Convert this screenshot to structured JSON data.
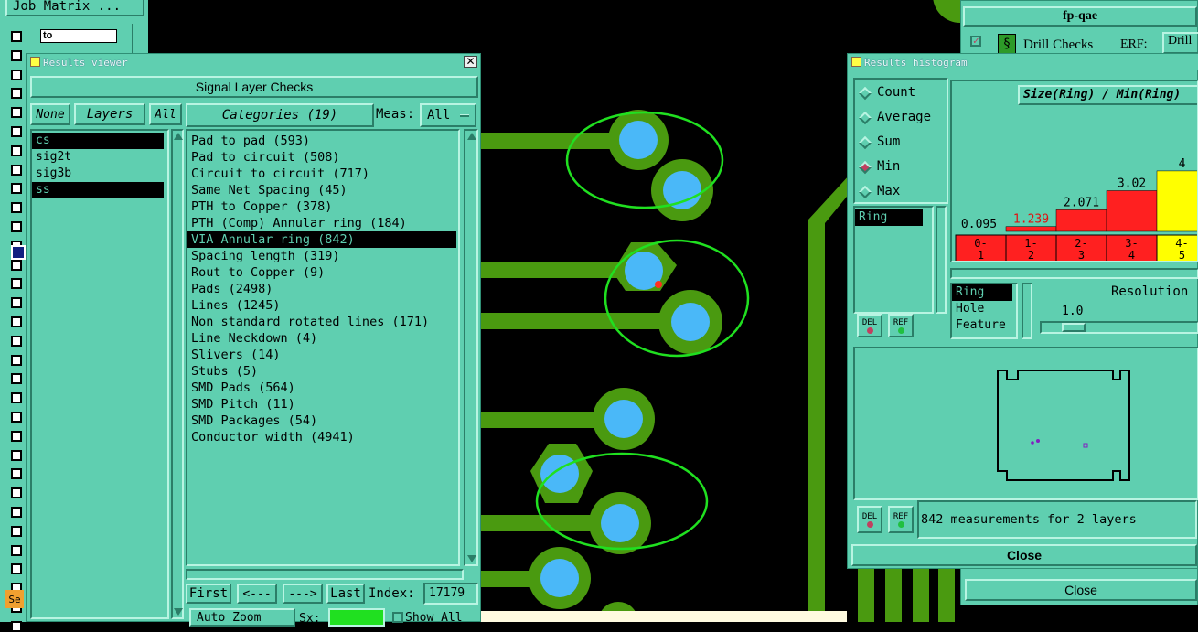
{
  "colors": {
    "panel": "#5fcfb0",
    "copper": "#4a9a10",
    "pad": "#4ab8f8",
    "highlight": "#20e020",
    "bar_red": "#ff2020",
    "bar_yellow": "#ffff00"
  },
  "job_matrix": {
    "title": "Job Matrix ...",
    "field_value": "to"
  },
  "results_viewer": {
    "title": "Results viewer",
    "header": "Signal Layer Checks",
    "none_btn": "None",
    "layers_btn": "Layers",
    "all_btn": "All",
    "layers": [
      "cs",
      "sig2t",
      "sig3b",
      "ss"
    ],
    "categories_btn": "Categories (19)",
    "meas_label": "Meas:",
    "meas_value": "All",
    "categories": [
      "Pad to pad (593)",
      "Pad to circuit (508)",
      "Circuit to circuit (717)",
      "Same Net Spacing (45)",
      "PTH to Copper (378)",
      "PTH (Comp) Annular ring (184)",
      "VIA Annular ring (842)",
      "Spacing length (319)",
      "Rout to Copper (9)",
      "Pads (2498)",
      "Lines (1245)",
      "Non standard rotated lines (171)",
      "Line Neckdown (4)",
      "Slivers (14)",
      "Stubs (5)",
      "SMD Pads (564)",
      "SMD Pitch (11)",
      "SMD Packages (54)",
      "Conductor width (4941)"
    ],
    "first_btn": "First",
    "prev_btn": "<---",
    "next_btn": "--->",
    "last_btn": "Last",
    "index_label": "Index:",
    "index_value": "17179",
    "auto_zoom_btn": "Auto Zoom",
    "sx_label": "Sx:",
    "show_all_label": "Show All",
    "se_tab": "Se"
  },
  "drill_window": {
    "job_name": "fp-qae",
    "check_label": "Drill Checks",
    "erf_label": "ERF:",
    "erf_value": "Drill",
    "close_btn": "Close"
  },
  "histogram": {
    "title": "Results histogram",
    "modes": [
      "Count",
      "Average",
      "Sum",
      "Min",
      "Max"
    ],
    "selected_mode": "Min",
    "chart_title": "Size(Ring) / Min(Ring)",
    "measure_list": [
      "Ring"
    ],
    "types": [
      "Ring",
      "Hole",
      "Feature"
    ],
    "resolution_label": "Resolution",
    "resolution_value": "1.0",
    "del_btn": "DEL",
    "ref_btn": "REF",
    "status": "842 measurements for 2 layers",
    "close_btn": "Close"
  },
  "chart_data": {
    "type": "bar",
    "title": "Size(Ring) / Min(Ring)",
    "categories": [
      "0-1",
      "1-2",
      "2-3",
      "3-4",
      "4-5"
    ],
    "category_labels": [
      [
        "0-",
        "1"
      ],
      [
        "1-",
        "2"
      ],
      [
        "2-",
        "3"
      ],
      [
        "3-",
        "4"
      ],
      [
        "4-",
        "5"
      ]
    ],
    "values": [
      0.095,
      1.239,
      2.071,
      3.02,
      4
    ],
    "value_labels": [
      "0.095",
      "1.239",
      "2.071",
      "3.02",
      "4"
    ],
    "bar_colors": [
      "#ff2020",
      "#ff2020",
      "#ff2020",
      "#ff2020",
      "#ffff00"
    ],
    "ylim": [
      0,
      4.3
    ]
  }
}
